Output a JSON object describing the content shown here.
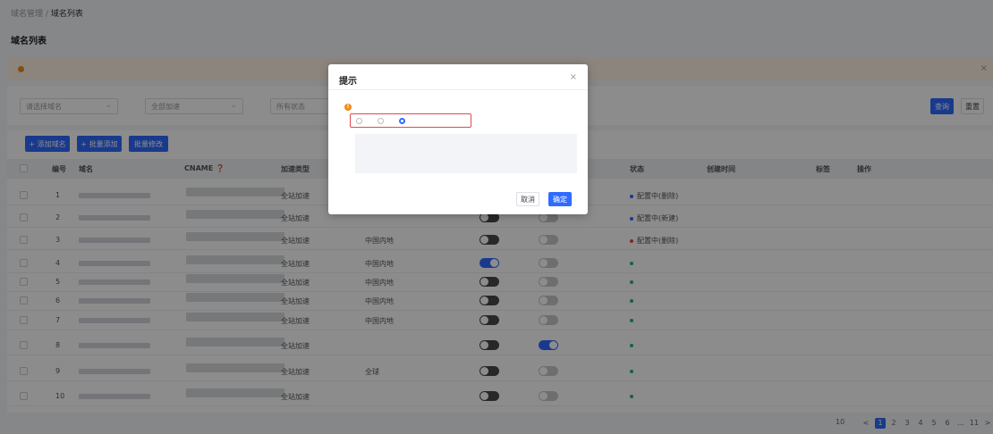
{
  "breadcrumb": {
    "parent": "域名管理",
    "sep": "/",
    "current": "域名列表"
  },
  "page_title": "域名列表",
  "notice": {
    "close": "×"
  },
  "filters": {
    "domain_select": "请选择域名",
    "accel_select": "全部加速",
    "status_select": "所有状态",
    "search_label": "查询",
    "reset_label": "重置"
  },
  "toolbar": {
    "add_domain": "+ 添加域名",
    "bulk_add": "+ 批量添加",
    "bulk_edit": "批量修改",
    "settings": ""
  },
  "table": {
    "headers": {
      "no": "编号",
      "domain": "域名",
      "cname": "CNAME ❓",
      "accel_type": "加速类型",
      "scope": "",
      "col_a": "",
      "col_b": "",
      "status": "状态",
      "created": "创建时间",
      "tag": "标签",
      "ops": "操作"
    },
    "rows": [
      {
        "no": "1",
        "type": "全站加速",
        "scope": "",
        "toggleA": false,
        "toggleB": false,
        "status": "配置中(删除)",
        "status_color": "#2f6bff",
        "created": "",
        "tag": "",
        "ops": [
          "",
          ""
        ]
      },
      {
        "no": "2",
        "type": "全站加速",
        "scope": "",
        "toggleA": false,
        "toggleB": false,
        "status": "配置中(新建)",
        "status_color": "#2f6bff",
        "created": "",
        "tag": "",
        "ops": [
          "",
          ""
        ]
      },
      {
        "no": "3",
        "type": "全站加速",
        "scope": "中国内地",
        "toggleA": false,
        "toggleB": false,
        "status": "配置中(删除)",
        "status_color": "#e34a4a",
        "created": "",
        "tag": "",
        "ops": [
          ""
        ]
      },
      {
        "no": "4",
        "type": "全站加速",
        "scope": "中国内地",
        "toggleA": true,
        "toggleB": false,
        "status": "",
        "status_color": "#2fb36b",
        "created": "",
        "tag": "",
        "ops": [
          "",
          "",
          ""
        ]
      },
      {
        "no": "5",
        "type": "全站加速",
        "scope": "中国内地",
        "toggleA": false,
        "toggleB": false,
        "status": "",
        "status_color": "#2fb36b",
        "created": "",
        "tag": "",
        "ops": [
          "",
          "",
          ""
        ]
      },
      {
        "no": "6",
        "type": "全站加速",
        "scope": "中国内地",
        "toggleA": false,
        "toggleB": false,
        "status": "",
        "status_color": "#2fb36b",
        "created": "",
        "tag": "",
        "ops": [
          "",
          "",
          ""
        ]
      },
      {
        "no": "7",
        "type": "全站加速",
        "scope": "中国内地",
        "toggleA": false,
        "toggleB": false,
        "status": "",
        "status_color": "#2fb36b",
        "created": "",
        "tag": "",
        "ops": [
          "",
          "",
          ""
        ]
      },
      {
        "no": "8",
        "type": "全站加速",
        "scope": "",
        "toggleA": false,
        "toggleB": true,
        "toggleB_label": "",
        "status": "",
        "status_color": "#2fb36b",
        "created": "",
        "tag": "",
        "ops": [
          "",
          "",
          ""
        ]
      },
      {
        "no": "9",
        "type": "全站加速",
        "scope": "全球",
        "toggleA": false,
        "toggleB": false,
        "status": "",
        "status_color": "#2fb36b",
        "created": "",
        "tag": "",
        "ops": [
          "",
          "",
          ""
        ]
      },
      {
        "no": "10",
        "type": "全站加速",
        "scope": "",
        "toggleA": false,
        "toggleB": false,
        "status": "",
        "status_color": "#2fb36b",
        "created": "",
        "tag": "",
        "ops": [
          "",
          "",
          ""
        ]
      }
    ]
  },
  "pagination": {
    "total": "",
    "per_page": "10",
    "pages": [
      "1",
      "2",
      "3",
      "4",
      "5",
      "6",
      "…",
      "11"
    ],
    "prev": "<",
    "next": ">"
  },
  "modal": {
    "title": "提示",
    "close": "×",
    "question": "",
    "options": [
      "",
      "",
      ""
    ],
    "selected_index": 2,
    "desc": [
      "",
      "",
      "",
      ""
    ],
    "cancel": "取消",
    "ok": "确定"
  },
  "colors": {
    "primary": "#2f6bff",
    "warning": "#f08c1a",
    "danger": "#e34a4a",
    "success": "#2fb36b"
  }
}
